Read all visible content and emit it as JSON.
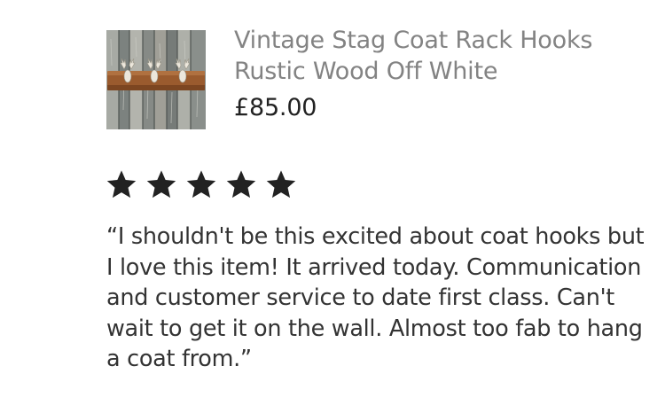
{
  "product": {
    "image_alt": "Vintage Stag Coat Rack Hooks Rustic Wood Off White",
    "title": "Vintage Stag Coat Rack Hooks Rustic Wood Off White",
    "price": "£85.00"
  },
  "review": {
    "rating": 5,
    "rating_max": 5,
    "star_color": "#222222",
    "text": "“I shouldn't be this excited about coat hooks but I love this item! It arrived today. Communication and customer service to date first class. Can't wait to get it on the wall. Almost too fab to hang a coat from.”"
  }
}
